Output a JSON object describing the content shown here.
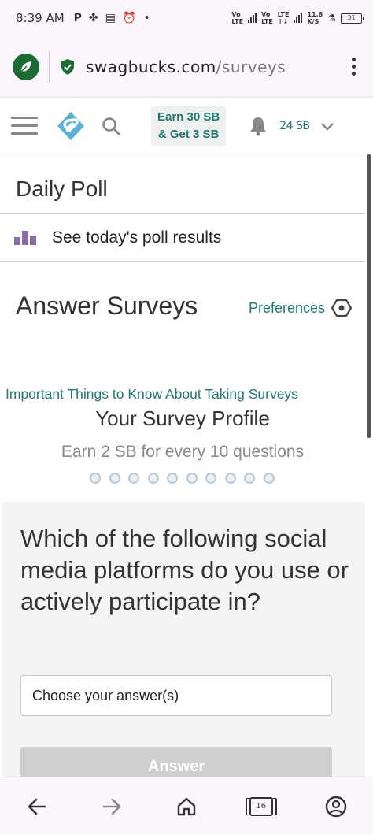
{
  "status_bar": {
    "time": "8:39 AM",
    "icons": [
      "P",
      "✤",
      "▤",
      "⏰",
      "•"
    ],
    "net1": [
      "Vo",
      "LTE"
    ],
    "net2": [
      "Vo",
      "LTE"
    ],
    "lte_label": "LTE",
    "lte_sub": "↑↓",
    "speed": "11.8",
    "speed_unit": "K/S",
    "battery": "31"
  },
  "browser": {
    "url_host": "swagbucks.com",
    "url_path": "/surveys"
  },
  "header": {
    "earn_line1": "Earn 30 SB",
    "earn_line2": "& Get 3 SB",
    "balance": "24 SB"
  },
  "daily_poll": {
    "title": "Daily Poll",
    "results_label": "See today's poll results"
  },
  "surveys": {
    "title": "Answer Surveys",
    "preferences_label": "Preferences",
    "important_link": "Important Things to Know About Taking Surveys",
    "profile_title": "Your Survey Profile",
    "profile_sub": "Earn 2 SB for every 10 questions",
    "progress_steps_total": 10,
    "progress_steps_done": 0
  },
  "question": {
    "text": "Which of the following social media platforms do you use or actively participate in?",
    "select_placeholder": "Choose your answer(s)",
    "answer_button": "Answer"
  },
  "bottom_nav": {
    "tabs_count": "16"
  },
  "colors": {
    "accent_teal": "#1e7a72",
    "poll_icon": "#8a6aa8",
    "brand_green": "#1b6b35"
  }
}
